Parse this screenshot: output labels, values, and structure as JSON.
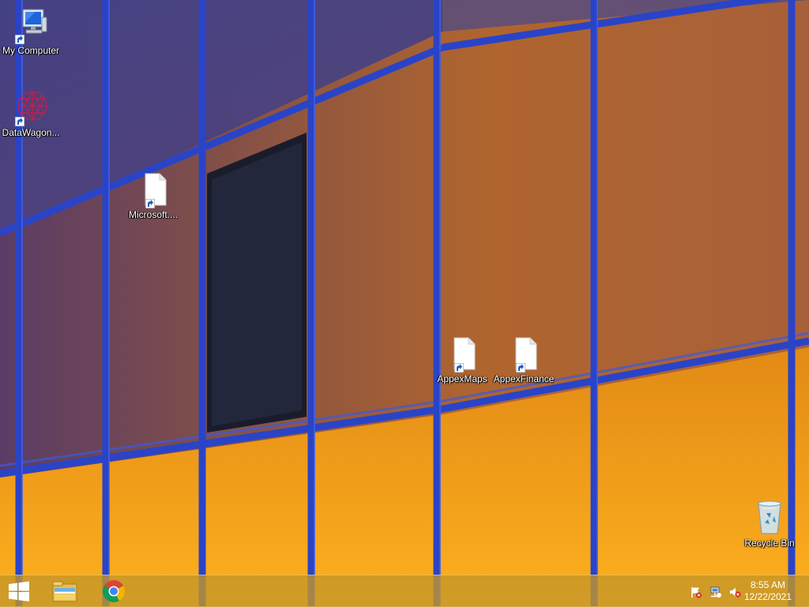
{
  "desktop": {
    "icons": [
      {
        "label": "My Computer"
      },
      {
        "label": "DataWagon..."
      },
      {
        "label": "Microsoft...."
      },
      {
        "label": "AppexMaps"
      },
      {
        "label": "AppexFinance"
      },
      {
        "label": "Recycle Bin"
      }
    ]
  },
  "taskbar": {
    "start_icon": "windows-logo-icon",
    "pinned": [
      {
        "name": "file-explorer-icon"
      },
      {
        "name": "chrome-icon"
      }
    ],
    "tray": [
      {
        "name": "action-center-flag-icon"
      },
      {
        "name": "network-icon"
      },
      {
        "name": "volume-muted-icon"
      }
    ],
    "clock": {
      "time": "8:55 AM",
      "date": "12/22/2021"
    }
  },
  "colors": {
    "mullion": "#2a44c8",
    "upper_panel": "#9a5a3a",
    "lower_panel": "#f6a41a",
    "taskbar": "#c49628"
  }
}
